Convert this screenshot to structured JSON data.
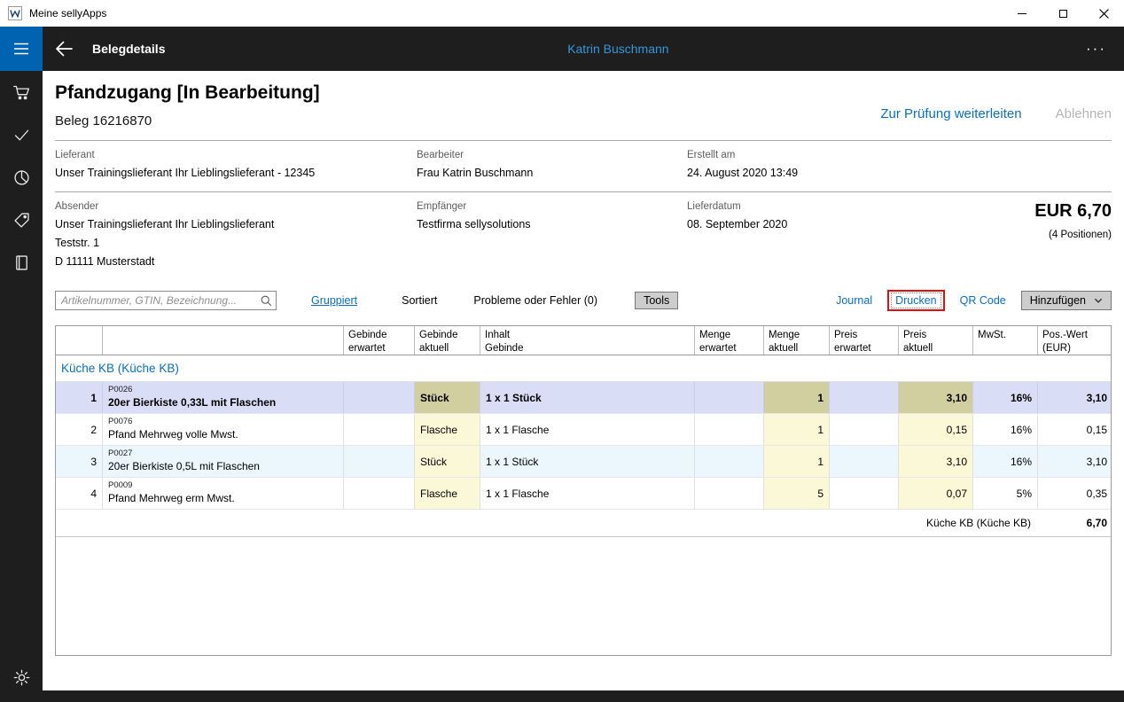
{
  "window": {
    "title": "Meine sellyApps",
    "controls": [
      "minimize",
      "maximize",
      "close"
    ]
  },
  "appbar": {
    "title": "Belegdetails",
    "user": "Katrin Buschmann",
    "more": "···"
  },
  "sidebar": {
    "icons": [
      "hamburger-menu",
      "shopping-cart",
      "checkmark",
      "pie-chart",
      "price-tag",
      "journal-book",
      "settings-gear"
    ]
  },
  "doc": {
    "title": "Pfandzugang [In Bearbeitung]",
    "beleg": "Beleg 16216870",
    "actions": {
      "forward": "Zur Prüfung weiterleiten",
      "reject": "Ablehnen"
    },
    "info": {
      "lieferant_label": "Lieferant",
      "lieferant_value": "Unser Trainingslieferant Ihr Lieblingslieferant - 12345",
      "bearbeiter_label": "Bearbeiter",
      "bearbeiter_value": "Frau Katrin Buschmann",
      "erstellt_label": "Erstellt am",
      "erstellt_value": "24. August 2020 13:49",
      "absender_label": "Absender",
      "absender_lines": [
        "Unser Trainingslieferant Ihr Lieblingslieferant",
        "Teststr. 1",
        "D 11111 Musterstadt"
      ],
      "empfaenger_label": "Empfänger",
      "empfaenger_value": "Testfirma sellysolutions",
      "lieferdatum_label": "Lieferdatum",
      "lieferdatum_value": "08. September 2020",
      "total": "EUR 6,70",
      "positions": "(4 Positionen)"
    },
    "toolbar": {
      "search_placeholder": "Artikelnummer, GTIN, Bezeichnung...",
      "gruppiert": "Gruppiert",
      "sortiert": "Sortiert",
      "probleme": "Probleme oder Fehler (0)",
      "tools": "Tools",
      "journal": "Journal",
      "drucken": "Drucken",
      "qr_code": "QR Code",
      "hinzufuegen": "Hinzufügen"
    },
    "table": {
      "headers": [
        "",
        "",
        "Gebinde\nerwartet",
        "Gebinde\naktuell",
        "Inhalt\nGebinde",
        "Menge\nerwartet",
        "Menge\naktuell",
        "Preis\nerwartet",
        "Preis\naktuell",
        "MwSt.",
        "Pos.-Wert\n(EUR)"
      ],
      "group_header": "Küche KB (Küche KB)",
      "rows": [
        {
          "num": "1",
          "code": "P0026",
          "name": "20er Bierkiste 0,33L mit Flaschen",
          "gebinde_aktuell": "Stück",
          "inhalt_gebinde": "1 x 1 Stück",
          "menge_aktuell": "1",
          "preis_aktuell": "3,10",
          "mwst": "16%",
          "pos_wert": "3,10"
        },
        {
          "num": "2",
          "code": "P0076",
          "name": "Pfand Mehrweg volle Mwst.",
          "gebinde_aktuell": "Flasche",
          "inhalt_gebinde": "1 x 1 Flasche",
          "menge_aktuell": "1",
          "preis_aktuell": "0,15",
          "mwst": "16%",
          "pos_wert": "0,15"
        },
        {
          "num": "3",
          "code": "P0027",
          "name": "20er Bierkiste 0,5L mit Flaschen",
          "gebinde_aktuell": "Stück",
          "inhalt_gebinde": "1 x 1 Stück",
          "menge_aktuell": "1",
          "preis_aktuell": "3,10",
          "mwst": "16%",
          "pos_wert": "3,10"
        },
        {
          "num": "4",
          "code": "P0009",
          "name": "Pfand Mehrweg erm Mwst.",
          "gebinde_aktuell": "Flasche",
          "inhalt_gebinde": "1 x 1 Flasche",
          "menge_aktuell": "5",
          "preis_aktuell": "0,07",
          "mwst": "5%",
          "pos_wert": "0,35"
        }
      ],
      "footer": {
        "group_total_label": "Küche KB (Küche KB)",
        "group_total_value": "6,70"
      }
    }
  },
  "colors": {
    "accent_blue": "#0a6ebd",
    "header_user_blue": "#3598db",
    "menu_box_blue": "#0063b1",
    "selected_row": "#d9def6",
    "selected_cell": "#d1cea0",
    "highlight_cell": "#fbf8d8",
    "alt_row": "#ecf6fd",
    "annotation_red": "#e01010"
  }
}
